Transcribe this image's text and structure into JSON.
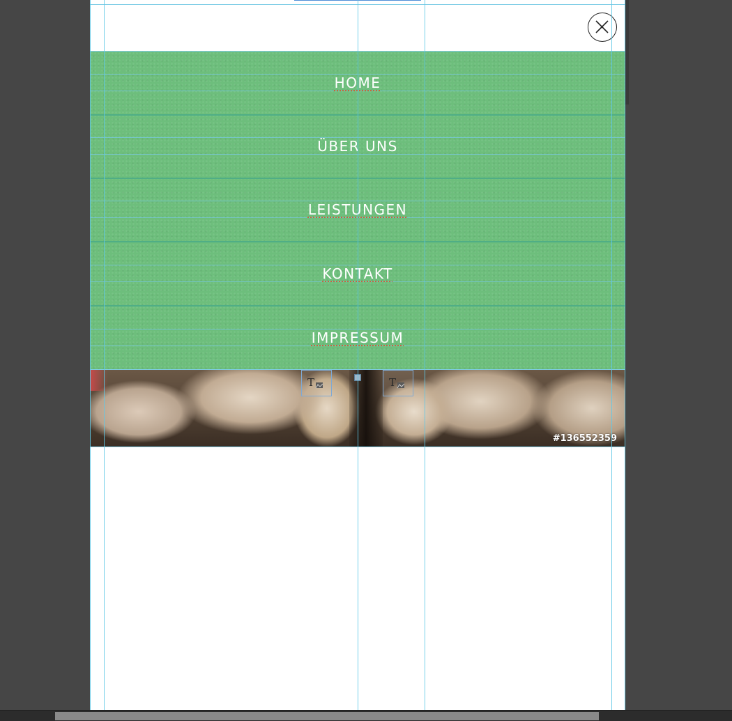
{
  "menu": {
    "items": [
      {
        "label": "HOME"
      },
      {
        "label": "ÜBER UNS"
      },
      {
        "label": "LEISTUNGEN"
      },
      {
        "label": "KONTAKT"
      },
      {
        "label": "IMPRESSUM"
      }
    ],
    "background_color": "#6dbe7c",
    "divider_color": "#4fae86",
    "text_color": "#ffffff"
  },
  "close_button": {
    "icon": "close-icon"
  },
  "banner": {
    "image_id": "#136552359",
    "placeholder_icons": [
      "text-image-placeholder-icon",
      "text-image-placeholder-icon"
    ]
  },
  "colors": {
    "workspace": "#464646",
    "artboard": "#ffffff",
    "guide": "#5fc8e6",
    "scrollbar_thumb": "#8a8a8a"
  }
}
